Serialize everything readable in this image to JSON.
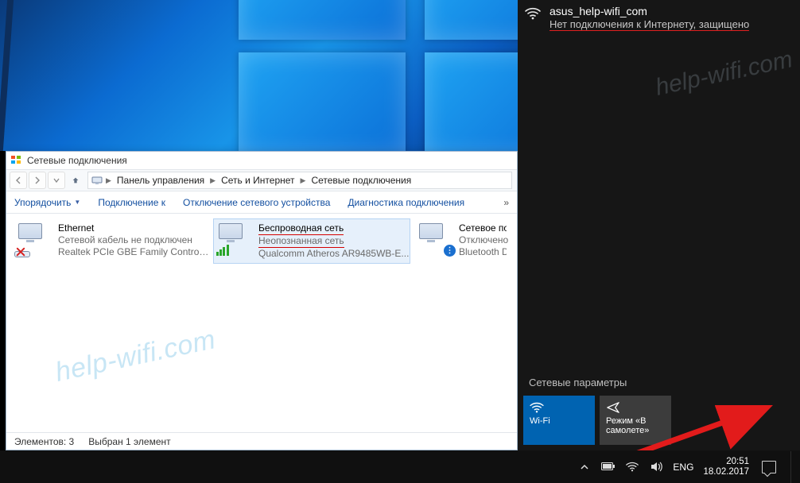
{
  "watermark": "help-wifi.com",
  "window": {
    "title": "Сетевые подключения",
    "breadcrumbs": [
      "Панель управления",
      "Сеть и Интернет",
      "Сетевые подключения"
    ],
    "toolbar": {
      "organize": "Упорядочить",
      "connect_to": "Подключение к",
      "disable": "Отключение сетевого устройства",
      "diagnose": "Диагностика подключения"
    },
    "adapters": [
      {
        "name": "Ethernet",
        "status": "Сетевой кабель не подключен",
        "device": "Realtek PCIe GBE Family Controller",
        "kind": "ethernet",
        "selected": false
      },
      {
        "name": "Беспроводная сеть",
        "status": "Неопознанная сеть",
        "device": "Qualcomm Atheros AR9485WB-E...",
        "kind": "wifi",
        "selected": true
      },
      {
        "name": "Сетевое по",
        "status": "Отключено",
        "device": "Bluetooth D",
        "kind": "bluetooth",
        "selected": false
      }
    ],
    "status": {
      "count_label": "Элементов: 3",
      "selection_label": "Выбран 1 элемент"
    }
  },
  "flyout": {
    "network_name": "asus_help-wifi_com",
    "network_status": "Нет подключения к Интернету, защищено",
    "settings_label": "Сетевые параметры",
    "buttons": {
      "wifi": "Wi-Fi",
      "airplane": "Режим «В самолете»"
    }
  },
  "tray": {
    "lang": "ENG",
    "time": "20:51",
    "date": "18.02.2017"
  }
}
